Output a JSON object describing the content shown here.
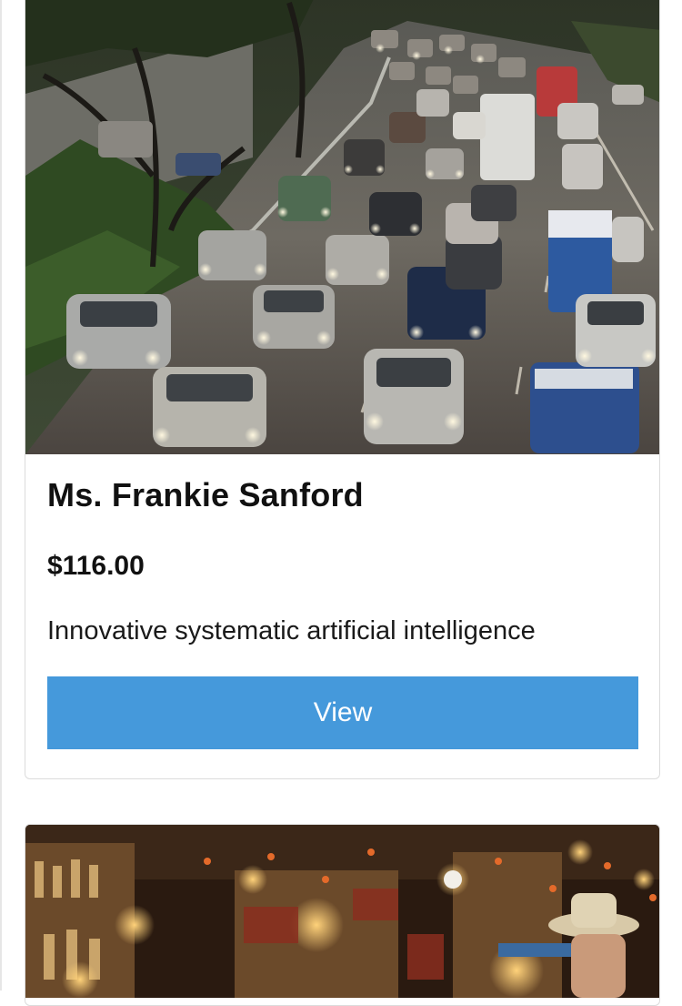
{
  "products": [
    {
      "image_subject": "traffic-highway-photo",
      "name": "Ms. Frankie Sanford",
      "price": "$116.00",
      "description": "Innovative systematic artificial intelligence",
      "button_label": "View"
    },
    {
      "image_subject": "bar-interior-photo"
    }
  ],
  "colors": {
    "button_bg": "#4599db",
    "button_text": "#ffffff",
    "card_border": "#dcdcdc",
    "text": "#111111"
  }
}
